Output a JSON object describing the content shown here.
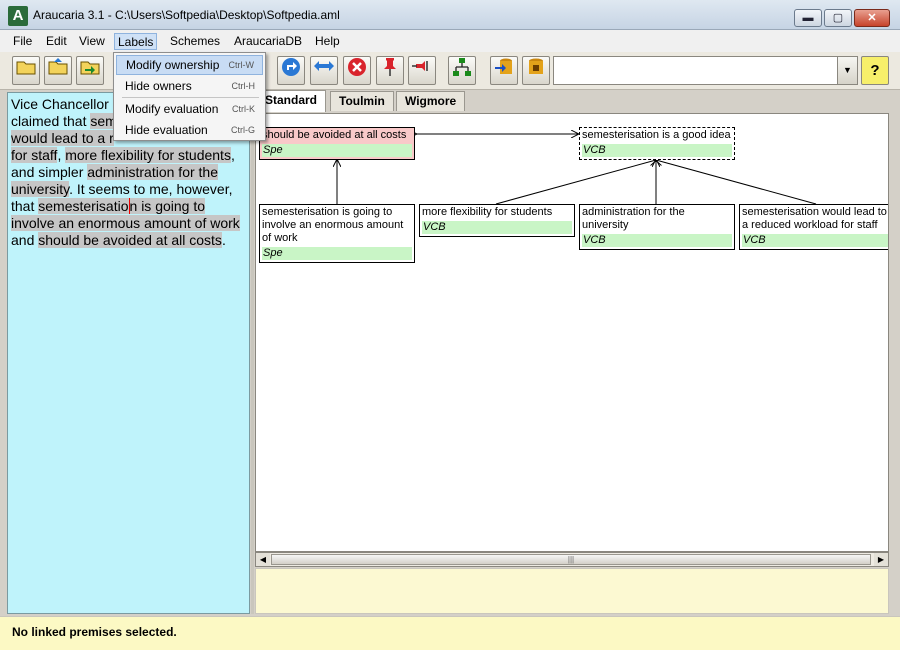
{
  "window": {
    "app_icon": "A",
    "title": "Araucaria 3.1  - C:\\Users\\Softpedia\\Desktop\\Softpedia.aml",
    "controls": {
      "minimize": "▬",
      "maximize": "▢",
      "close": "✕"
    }
  },
  "menu": {
    "file": "File",
    "edit": "Edit",
    "view": "View",
    "labels": "Labels",
    "schemes": "Schemes",
    "araucariadb": "AraucariaDB",
    "help": "Help"
  },
  "labels_menu": {
    "items": [
      {
        "label": "Modify ownership",
        "shortcut": "Ctrl-W"
      },
      {
        "label": "Hide owners",
        "shortcut": "Ctrl-H"
      },
      {
        "label": "Modify evaluation",
        "shortcut": "Ctrl-K"
      },
      {
        "label": "Hide evaluation",
        "shortcut": "Ctrl-G"
      }
    ]
  },
  "toolbar": {
    "icons": {
      "open": "open-folder-icon",
      "open-db": "open-database-icon",
      "import": "import-icon",
      "redo": "redo-arrow-icon",
      "link": "link-arrows-icon",
      "delete": "delete-icon",
      "pin": "pin-icon",
      "unpin": "unpin-icon",
      "tree": "tree-icon",
      "db-save": "db-save-icon",
      "db-load": "db-load-icon",
      "help": "help-icon"
    },
    "help_label": "?"
  },
  "text_panel": {
    "segments": [
      {
        "text": "Vice Chancellor ",
        "hl": false
      },
      {
        "text": "claimed that ",
        "hl": false
      },
      {
        "text": "sem",
        "hl": true
      },
      {
        "text": "would lead to a r",
        "hl": true
      },
      {
        "text": "for staff",
        "hl": true
      },
      {
        "text": ", ",
        "hl": false
      },
      {
        "text": "more flexibility for students",
        "hl": true
      },
      {
        "text": ", and simpler ",
        "hl": false
      },
      {
        "text": "administration for the university",
        "hl": true
      },
      {
        "text": ". It seems to me, however, that ",
        "hl": false
      },
      {
        "text": "semesterisatio",
        "hl": true
      },
      {
        "text": "n is going to involve an enormous amount of work",
        "hl": true
      },
      {
        "text": " and ",
        "hl": false
      },
      {
        "text": "should be avoided at all costs",
        "hl": true
      },
      {
        "text": ".",
        "hl": false
      }
    ]
  },
  "tabs": [
    "Standard",
    "Toulmin",
    "Wigmore"
  ],
  "diagram": {
    "nodes": [
      {
        "id": "n1",
        "text": "should be avoided at all costs",
        "owner": "Spe"
      },
      {
        "id": "n2",
        "text": "semesterisation is a good idea",
        "owner": "VCB"
      },
      {
        "id": "n3",
        "text": "semesterisation is going to involve an enormous amount of work",
        "owner": "Spe"
      },
      {
        "id": "n4",
        "text": "more flexibility for students",
        "owner": "VCB"
      },
      {
        "id": "n5",
        "text": "administration for the university",
        "owner": "VCB"
      },
      {
        "id": "n6",
        "text": "semesterisation would lead to a reduced workload for staff",
        "owner": "VCB"
      }
    ]
  },
  "scrollbar": {
    "left": "◀",
    "right": "▶",
    "grip": "|||"
  },
  "status": {
    "text": "No linked premises selected."
  }
}
